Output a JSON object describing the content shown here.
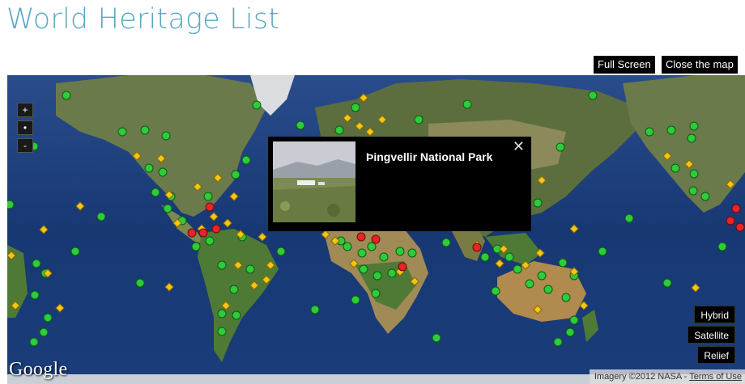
{
  "page": {
    "title": "World Heritage List"
  },
  "top_controls": {
    "fullscreen_label": "Full Screen",
    "close_label": "Close the map"
  },
  "zoom": {
    "in_label": "+",
    "reset_label": "•",
    "out_label": "-"
  },
  "map_types": {
    "hybrid": "Hybrid",
    "satellite": "Satellite",
    "relief": "Relief"
  },
  "popup": {
    "title": "Þingvellir National Park",
    "close_glyph": "✕"
  },
  "branding": {
    "logo": "Google",
    "imagery": "Imagery ©2012 NASA - ",
    "terms": "Terms of Use"
  },
  "legend_colors": {
    "natural": "#2ecc3a",
    "cultural": "#f5c518",
    "danger": "#e8232a",
    "ocean": "#1a3a78"
  }
}
